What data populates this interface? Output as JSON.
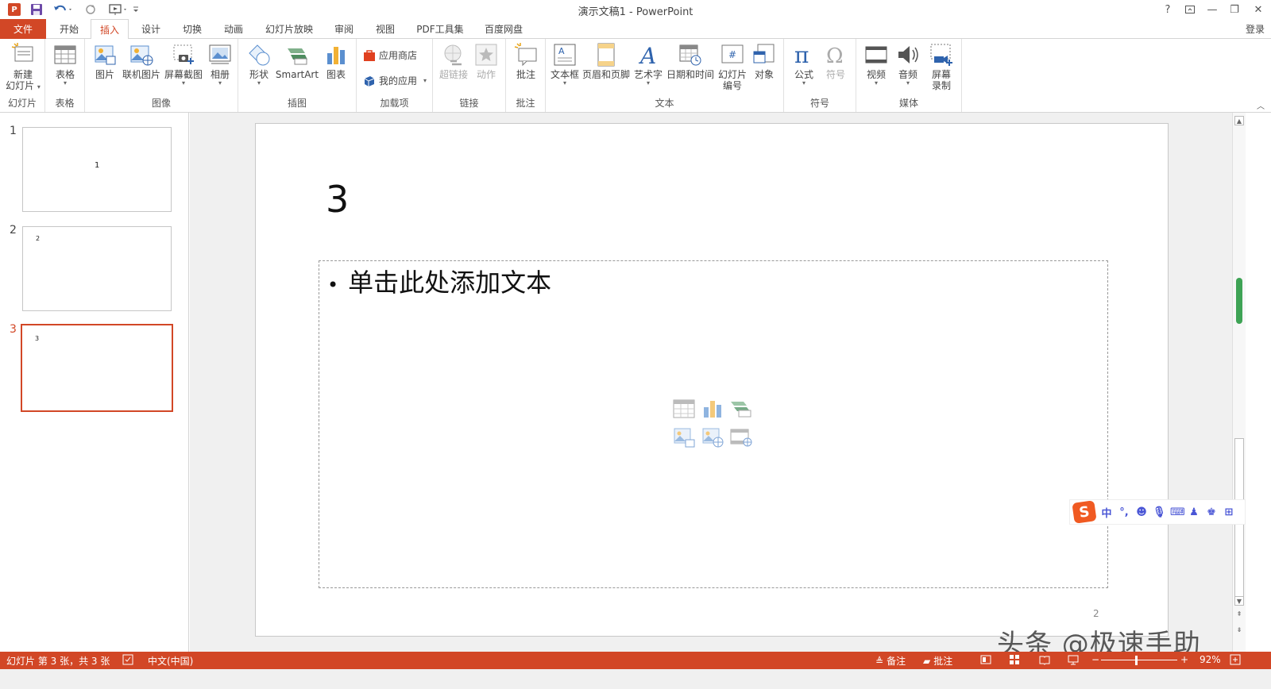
{
  "window": {
    "title": "演示文稿1 - PowerPoint",
    "app_logo": "P",
    "help": "?",
    "minimize": "—",
    "maximize": "❐",
    "close": "✕"
  },
  "tabs": [
    "文件",
    "开始",
    "插入",
    "设计",
    "切换",
    "动画",
    "幻灯片放映",
    "审阅",
    "视图",
    "PDF工具集",
    "百度网盘"
  ],
  "active_tab": "插入",
  "login": "登录",
  "ribbon": {
    "groups": {
      "slides": "幻灯片",
      "tables": "表格",
      "images": "图像",
      "illustrations": "插图",
      "addins": "加载项",
      "links": "链接",
      "comments": "批注",
      "text": "文本",
      "symbols": "符号",
      "media": "媒体"
    },
    "buttons": {
      "new_slide_1": "新建",
      "new_slide_2": "幻灯片",
      "table": "表格",
      "picture": "图片",
      "online_picture": "联机图片",
      "screenshot": "屏幕截图",
      "album": "相册",
      "shapes": "形状",
      "smartart": "SmartArt",
      "chart": "图表",
      "app_store": "应用商店",
      "my_apps": "我的应用",
      "hyperlink": "超链接",
      "action": "动作",
      "comment": "批注",
      "textbox": "文本框",
      "header_footer": "页眉和页脚",
      "wordart": "艺术字",
      "datetime": "日期和时间",
      "slide_number_1": "幻灯片",
      "slide_number_2": "编号",
      "object": "对象",
      "equation": "公式",
      "symbol": "符号",
      "video": "视频",
      "audio": "音频",
      "screen_record_1": "屏幕",
      "screen_record_2": "录制"
    }
  },
  "thumbnails": [
    {
      "number": "1",
      "text": "1"
    },
    {
      "number": "2",
      "text": "2"
    },
    {
      "number": "3",
      "text": "3"
    }
  ],
  "slide": {
    "title": "3",
    "placeholder": "单击此处添加文本",
    "bullet": "•",
    "number": "2"
  },
  "ime": {
    "logo": "S",
    "mode": "中"
  },
  "status": {
    "slide_info": "幻灯片 第 3 张，共 3 张",
    "language": "中文(中国)",
    "notes": "备注",
    "comments": "批注",
    "zoom": "92%",
    "zoom_level": 0.92
  },
  "watermark": "头条 @极速手助",
  "colors": {
    "accent": "#d24726",
    "scroll_indicator": "#3ea355"
  }
}
